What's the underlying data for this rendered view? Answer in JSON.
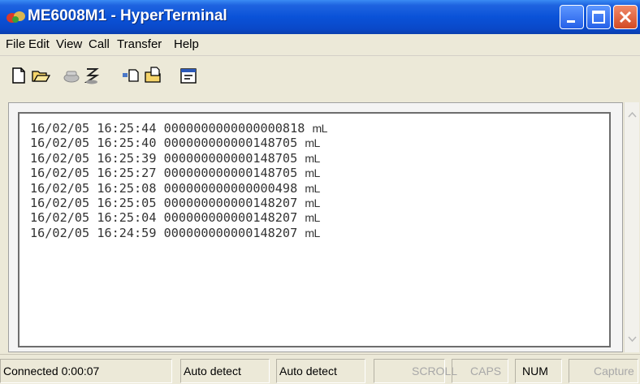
{
  "window": {
    "title": "ME6008M1 - HyperTerminal",
    "titlebar_color": "#0a52d8"
  },
  "menu": [
    {
      "label": "File"
    },
    {
      "label": "Edit"
    },
    {
      "label": "View"
    },
    {
      "label": "Call"
    },
    {
      "label": "Transfer"
    },
    {
      "label": "Help"
    }
  ],
  "toolbar": {
    "tools": [
      "new-document-icon",
      "open-folder-icon",
      "phone-connect-icon",
      "phone-disconnect-icon",
      "send-file-icon",
      "receive-file-icon",
      "properties-icon"
    ]
  },
  "terminal": {
    "lines": [
      {
        "date": "16/02/05",
        "time": "16:25:44",
        "value": "0000000000000000818",
        "unit": "mL"
      },
      {
        "date": "16/02/05",
        "time": "16:25:40",
        "value": "000000000000148705",
        "unit": "mL"
      },
      {
        "date": "16/02/05",
        "time": "16:25:39",
        "value": "000000000000148705",
        "unit": "mL"
      },
      {
        "date": "16/02/05",
        "time": "16:25:27",
        "value": "000000000000148705",
        "unit": "mL"
      },
      {
        "date": "16/02/05",
        "time": "16:25:08",
        "value": "000000000000000498",
        "unit": "mL"
      },
      {
        "date": "16/02/05",
        "time": "16:25:05",
        "value": "000000000000148207",
        "unit": "mL"
      },
      {
        "date": "16/02/05",
        "time": "16:25:04",
        "value": "000000000000148207",
        "unit": "mL"
      },
      {
        "date": "16/02/05",
        "time": "16:24:59",
        "value": "000000000000148207",
        "unit": "mL"
      }
    ]
  },
  "status": {
    "connected": "Connected 0:00:07",
    "detect1": "Auto detect",
    "detect2": "Auto detect",
    "scroll": "SCROLL",
    "caps": "CAPS",
    "num": "NUM",
    "capture": "Capture"
  }
}
